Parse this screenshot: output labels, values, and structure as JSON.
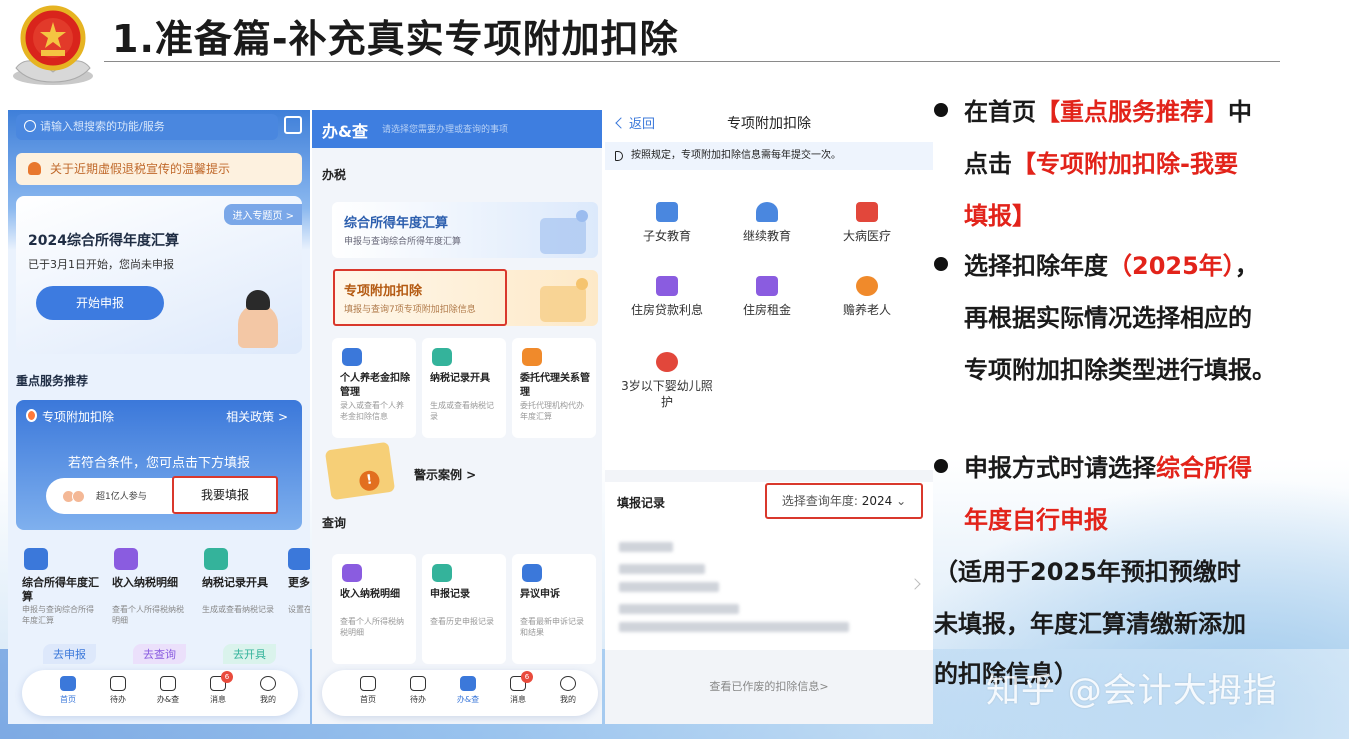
{
  "slide": {
    "title": "1.准备篇-补充真实专项附加扣除",
    "watermark": "知乎 @会计大拇指"
  },
  "phone1": {
    "search_placeholder": "请输入想搜索的功能/服务",
    "notice": "关于近期虚假退税宣传的温馨提示",
    "card": {
      "enter": "进入专题页 >",
      "title": "2024综合所得年度汇算",
      "subtitle": "已于3月1日开始，您尚未申报",
      "button": "开始申报"
    },
    "section_title": "重点服务推荐",
    "special": {
      "title": "专项附加扣除",
      "policy": "相关政策 >",
      "message": "若符合条件，您可点击下方填报",
      "participants": "超1亿人参与",
      "fill_button": "我要填报"
    },
    "services": [
      {
        "name": "综合所得年度汇算",
        "desc": "申报与查询综合所得年度汇算",
        "action": "去申报"
      },
      {
        "name": "收入纳税明细",
        "desc": "查看个人所得税纳税明细",
        "action": "去查询"
      },
      {
        "name": "纳税记录开具",
        "desc": "生成或查看纳税记录",
        "action": "去开具"
      },
      {
        "name": "更多功",
        "desc": "设置在常用功"
      }
    ],
    "tabbar": [
      {
        "label": "首页"
      },
      {
        "label": "待办"
      },
      {
        "label": "办&查"
      },
      {
        "label": "消息",
        "badge": "6"
      },
      {
        "label": "我的"
      }
    ]
  },
  "phone2": {
    "header_title": "办&查",
    "header_hint": "请选择您需要办理或查询的事项",
    "section_tax": "办税",
    "item_annual": {
      "title": "综合所得年度汇算",
      "desc": "申报与查询综合所得年度汇算"
    },
    "item_special": {
      "title": "专项附加扣除",
      "desc": "填报与查询7项专项附加扣除信息"
    },
    "minis_top": [
      {
        "name": "个人养老金扣除管理",
        "desc": "录入或查看个人养老金扣除信息"
      },
      {
        "name": "纳税记录开具",
        "desc": "生成或查看纳税记录"
      },
      {
        "name": "委托代理关系管理",
        "desc": "委托代理机构代办年度汇算"
      }
    ],
    "warning": "警示案例 >",
    "section_query": "查询",
    "minis_bottom": [
      {
        "name": "收入纳税明细",
        "desc": "查看个人所得税纳税明细"
      },
      {
        "name": "申报记录",
        "desc": "查看历史申报记录"
      },
      {
        "name": "异议申诉",
        "desc": "查看最新申诉记录和结果"
      }
    ],
    "tabbar": [
      {
        "label": "首页"
      },
      {
        "label": "待办"
      },
      {
        "label": "办&查"
      },
      {
        "label": "消息",
        "badge": "6"
      },
      {
        "label": "我的"
      }
    ]
  },
  "phone3": {
    "back": "返回",
    "title": "专项附加扣除",
    "tip": "按照规定，专项附加扣除信息需每年提交一次。",
    "items": [
      {
        "label": "子女教育"
      },
      {
        "label": "继续教育"
      },
      {
        "label": "大病医疗"
      },
      {
        "label": "住房贷款利息"
      },
      {
        "label": "住房租金"
      },
      {
        "label": "赡养老人"
      },
      {
        "label": "3岁以下婴幼儿照护"
      }
    ],
    "record_title": "填报记录",
    "year_label": "选择查询年度:",
    "year_value": "2024",
    "view_voided": "查看已作废的扣除信息>"
  },
  "bullets": {
    "b1_a": "在首页",
    "b1_b": "【重点服务推荐】",
    "b1_c": "中",
    "b1_d": "点击",
    "b1_e": "【专项附加扣除-我要",
    "b1_f": "填报】",
    "b2_a": "选择扣除年度",
    "b2_b": "（2025年）",
    "b2_c": "，",
    "b2_d": "再根据实际情况选择相应的",
    "b2_e": "专项附加扣除类型进行填报。",
    "b3_a": "申报方式时请选择",
    "b3_b": "综合所得",
    "b3_c": "年度自行申报",
    "b3_d": "（适用于2025年预扣预缴时",
    "b3_e": "未填报，年度汇算清缴新添加",
    "b3_f": "的扣除信息）"
  },
  "colors": {
    "accent_blue": "#3b78da",
    "highlight_red": "#e2231a",
    "box_red": "#d9382c"
  }
}
